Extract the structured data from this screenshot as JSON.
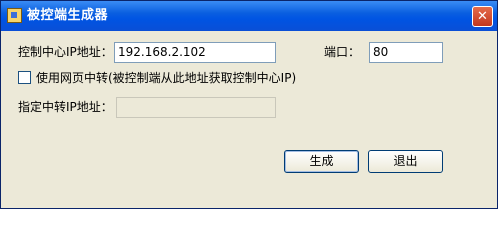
{
  "window": {
    "title": "被控端生成器",
    "close_glyph": "✕"
  },
  "form": {
    "server_ip_label": "控制中心IP地址：",
    "server_ip_value": "192.168.2.102",
    "port_label": "端口：",
    "port_value": "80",
    "relay_checkbox_label": "使用网页中转(被控制端从此地址获取控制中心IP)",
    "relay_checked": false,
    "relay_ip_label": "指定中转IP地址：",
    "relay_ip_value": ""
  },
  "buttons": {
    "generate": "生成",
    "exit": "退出"
  }
}
